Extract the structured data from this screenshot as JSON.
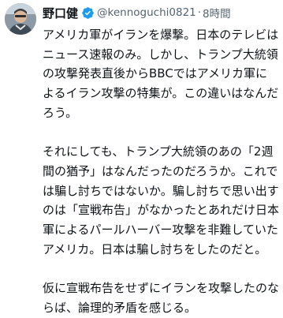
{
  "tweet": {
    "author_name": "野口健",
    "handle": "@kennoguchi0821",
    "separator": "·",
    "time": "8時間",
    "verified": true,
    "icons": {
      "avatar": "profile-photo",
      "verified": "verified-badge-icon"
    },
    "colors": {
      "verified_badge": "#1d9bf0",
      "handle": "#536471",
      "text": "#0f1419"
    },
    "paragraphs": [
      "アメリカ軍がイランを爆撃。日本のテレビはニュース速報のみ。しかし、トランプ大統領の攻撃発表直後からBBCではアメリカ軍によるイラン攻撃の特集が。この違いはなんだろう。",
      "それにしても、トランプ大統領のあの「2週間の猶予」はなんだったのだろうか。これでは騙し討ちではないか。騙し討ちで思い出すのは「宣戦布告」がなかったとあれだけ日本軍によるパールハーバー攻撃を非難していたアメリカ。日本は騙し討ちをしたのだと。",
      "仮に宣戦布告をせずにイランを攻撃したのならば、論理的矛盾を感じる。"
    ]
  }
}
